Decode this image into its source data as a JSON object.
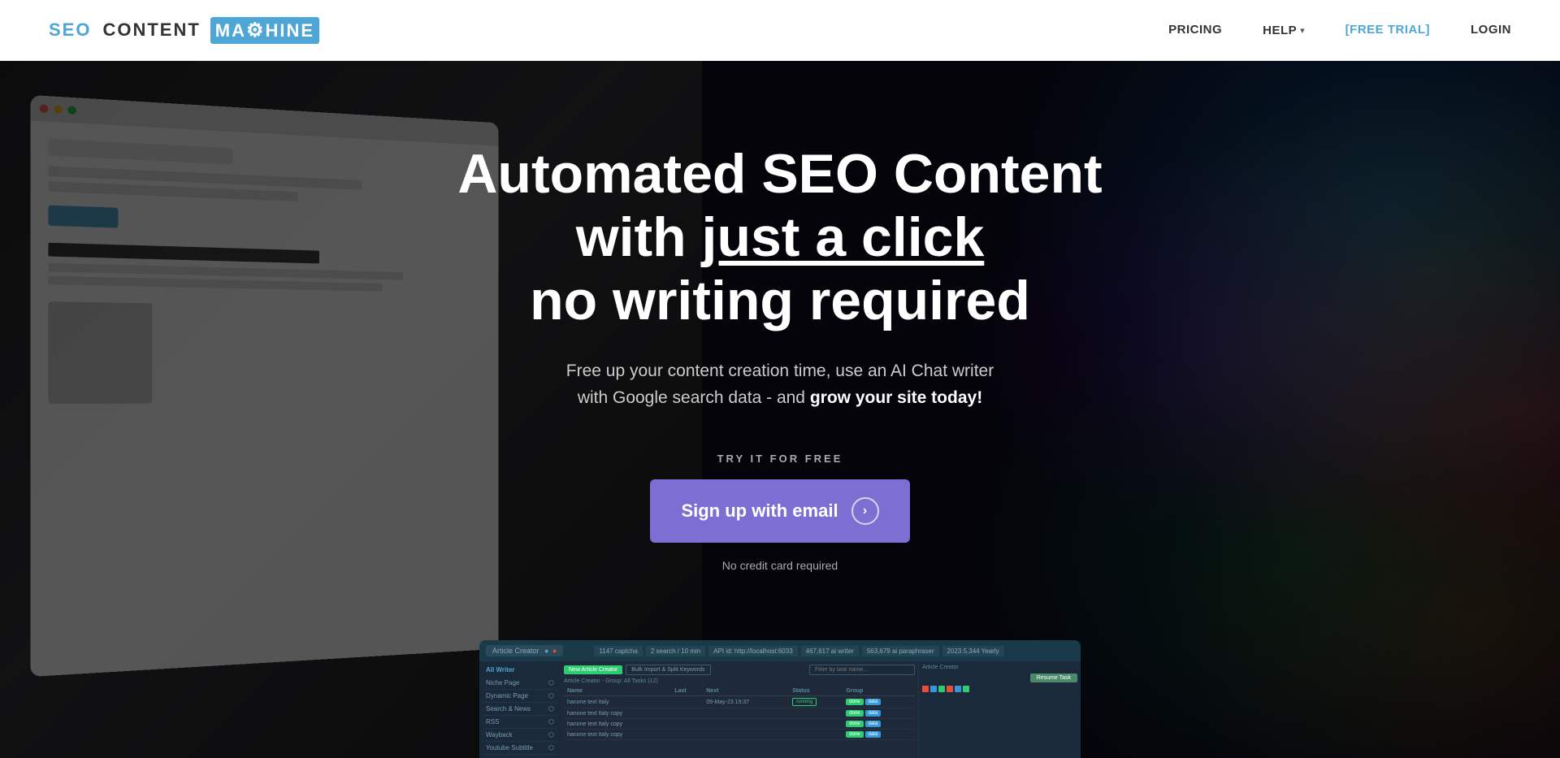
{
  "nav": {
    "logo": {
      "seo": "SEO",
      "content": "CONTENT",
      "machine": "MA⚙HINE"
    },
    "links": [
      {
        "id": "pricing",
        "label": "PRICING"
      },
      {
        "id": "help",
        "label": "HELP",
        "has_dropdown": true
      },
      {
        "id": "free-trial",
        "label": "[FREE TRIAL]",
        "style": "accent"
      },
      {
        "id": "login",
        "label": "LOGIN"
      }
    ]
  },
  "hero": {
    "headline_line1": "Automated SEO Content",
    "headline_line2_start": "with ",
    "headline_line2_emphasis": "just a click",
    "headline_line3": "no writing required",
    "subtext_line1": "Free up your content creation time, use an AI Chat writer",
    "subtext_line2_start": "with Google search data - and ",
    "subtext_line2_bold": "grow your site today!",
    "try_free_label": "TRY IT FOR FREE",
    "signup_button": "Sign up with email",
    "no_credit": "No credit card required"
  },
  "dashboard": {
    "tab_label": "Article Creator",
    "stats": [
      "1147 captcha",
      "2 search / 10 min",
      "API id: http://localhost:6033",
      "467,617 ai writer",
      "563,679 ai paraphraser",
      "2023.5,344 Yearly"
    ],
    "toolbar": {
      "new_article_btn": "New Article Creator",
      "bulk_import_btn": "Bulk Import & Split Keywords",
      "filter_placeholder": "Filter by task name...",
      "group_label": "Article Creator - Group: All Tasks (12)"
    },
    "sidebar_items": [
      "Niche Page",
      "Dynamic Page",
      "Search & News",
      "RSS",
      "Wayback",
      "Youtube Subtitle"
    ],
    "table": {
      "headers": [
        "Name",
        "Last",
        "Next",
        "Status",
        "Group"
      ],
      "rows": [
        {
          "name": "hanone text Italy",
          "last": "",
          "next": "09-May-23 19:37",
          "status": "running",
          "badges": [
            "done",
            "data"
          ]
        },
        {
          "name": "hanone text Italy copy",
          "last": "",
          "next": "",
          "status": "",
          "badges": [
            "done",
            "data"
          ]
        },
        {
          "name": "hanone text Italy copy",
          "last": "",
          "next": "",
          "status": "",
          "badges": [
            "done",
            "data"
          ]
        },
        {
          "name": "hanone text Italy copy",
          "last": "",
          "next": "",
          "status": "",
          "badges": [
            "done",
            "data"
          ]
        }
      ]
    },
    "right_panel": {
      "header": "Article Creator",
      "resume_btn": "Resume Task"
    }
  },
  "colors": {
    "accent_blue": "#4da6d6",
    "accent_purple": "#7b6fd4",
    "nav_bg": "#ffffff",
    "hero_dark": "#1a1a2e"
  }
}
